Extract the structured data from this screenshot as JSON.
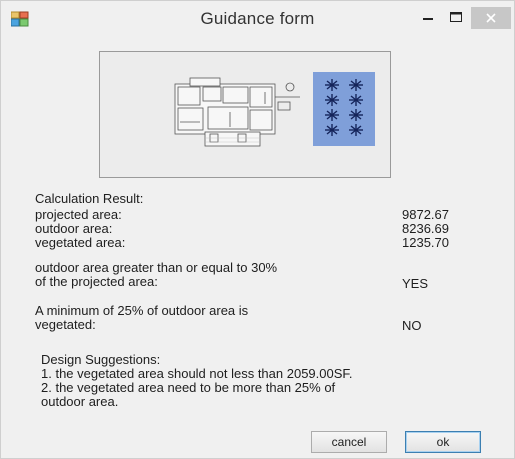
{
  "window": {
    "title": "Guidance form"
  },
  "result": {
    "heading": "Calculation Result:",
    "rows": [
      {
        "label": "projected area:",
        "value": "9872.67"
      },
      {
        "label": "outdoor area:",
        "value": "8236.69"
      },
      {
        "label": "vegetated area:",
        "value": "1235.70"
      }
    ]
  },
  "checks": [
    {
      "line1": "outdoor area greater than or equal to 30%",
      "line2": "of the projected area:",
      "answer": "YES"
    },
    {
      "line1": "A minimum of 25% of outdoor area is",
      "line2": "vegetated:",
      "answer": "NO"
    }
  ],
  "suggestions": {
    "heading": "Design Suggestions:",
    "line1": "1. the vegetated area should not less than 2059.00SF.",
    "line2": "2. the vegetated area need to be more than 25% of",
    "line3": "outdoor area."
  },
  "buttons": {
    "cancel": "cancel",
    "ok": "ok"
  },
  "colors": {
    "vegetation_panel": "#7f9fd9",
    "close_button": "#c7c7c7"
  }
}
